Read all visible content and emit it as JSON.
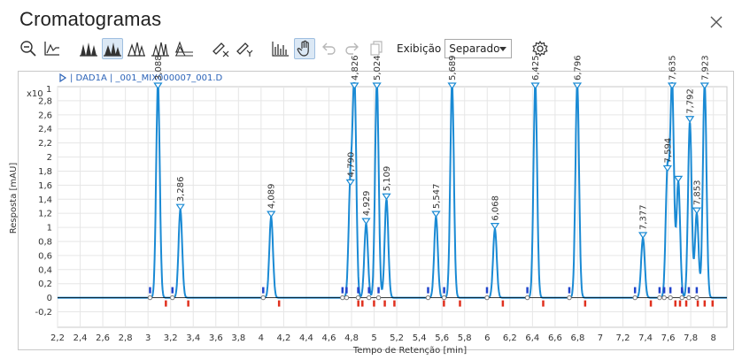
{
  "window": {
    "title": "Cromatogramas"
  },
  "toolbar": {
    "buttons": [
      {
        "icon": "zoom-out-icon"
      },
      {
        "icon": "baseline-icon"
      },
      {
        "icon": "peaks-filled-icon"
      },
      {
        "icon": "peaks-overlay-icon",
        "active": true
      },
      {
        "icon": "peaks-outline-icon"
      },
      {
        "icon": "peaks-split-icon"
      },
      {
        "icon": "peaks-stacked-icon"
      },
      {
        "icon": "remove-x-icon"
      },
      {
        "icon": "remove-y-icon"
      },
      {
        "icon": "spectrum-icon"
      },
      {
        "icon": "pan-hand-icon",
        "active": true
      },
      {
        "icon": "undo-icon",
        "disabled": true
      },
      {
        "icon": "redo-icon",
        "disabled": true
      },
      {
        "icon": "copy-icon",
        "disabled": true
      }
    ],
    "display_label": "Exibição",
    "display_value": "Separado",
    "settings_icon": "gear-icon"
  },
  "trace": {
    "header": "| DAD1A | _001_MIX000007_001.D"
  },
  "chart_data": {
    "type": "line",
    "xlabel": "Tempo de Retenção [min]",
    "ylabel": "Resposta [mAU]",
    "y_multiplier": "x10",
    "y_multiplier_exp": "1",
    "xlim": [
      2.2,
      8.12
    ],
    "ylim": [
      -0.42,
      3.0
    ],
    "x_ticks": [
      "2,2",
      "2,4",
      "2,6",
      "2,8",
      "3",
      "3,2",
      "3,4",
      "3,6",
      "3,8",
      "4",
      "4,2",
      "4,4",
      "4,6",
      "4,8",
      "5",
      "5,2",
      "5,4",
      "5,6",
      "5,8",
      "6",
      "6,2",
      "6,4",
      "6,6",
      "6,8",
      "7",
      "7,2",
      "7,4",
      "7,6",
      "7,8",
      "8"
    ],
    "y_ticks": [
      "-0,2",
      "0",
      "0,2",
      "0,4",
      "0,6",
      "0,8",
      "1",
      "1,2",
      "1,4",
      "1,6",
      "1,8",
      "2",
      "2,2",
      "2,4",
      "2,6",
      "2,8"
    ],
    "grid": true,
    "peaks": [
      {
        "rt": 3.088,
        "label": "3,088",
        "height": 3.05
      },
      {
        "rt": 3.286,
        "label": "3,286",
        "height": 1.25
      },
      {
        "rt": 4.089,
        "label": "4,089",
        "height": 1.15
      },
      {
        "rt": 4.79,
        "label": "4,790",
        "height": 1.6
      },
      {
        "rt": 4.826,
        "label": "4,826",
        "height": 3.05
      },
      {
        "rt": 4.929,
        "label": "4,929",
        "height": 1.05
      },
      {
        "rt": 5.024,
        "label": "5,024",
        "height": 3.05
      },
      {
        "rt": 5.109,
        "label": "5,109",
        "height": 1.4
      },
      {
        "rt": 5.547,
        "label": "5,547",
        "height": 1.15
      },
      {
        "rt": 5.689,
        "label": "5,689",
        "height": 3.05
      },
      {
        "rt": 6.068,
        "label": "6,068",
        "height": 0.98
      },
      {
        "rt": 6.425,
        "label": "6,425",
        "height": 3.05
      },
      {
        "rt": 6.796,
        "label": "6,796",
        "height": 3.05
      },
      {
        "rt": 7.377,
        "label": "7,377",
        "height": 0.85
      },
      {
        "rt": 7.594,
        "label": "7,594",
        "height": 1.8
      },
      {
        "rt": 7.635,
        "label": "7,635",
        "height": 3.05
      },
      {
        "rt": 7.69,
        "label": "",
        "height": 1.65
      },
      {
        "rt": 7.792,
        "label": "7,792",
        "height": 2.5
      },
      {
        "rt": 7.853,
        "label": "7,853",
        "height": 1.2
      },
      {
        "rt": 7.923,
        "label": "7,923",
        "height": 3.05
      }
    ],
    "colors": {
      "trace": "#1a8ad4",
      "baseline": "#000000",
      "grid": "#e6e6e6",
      "start_marker": "#2244cc",
      "end_marker": "#e0301e"
    }
  }
}
